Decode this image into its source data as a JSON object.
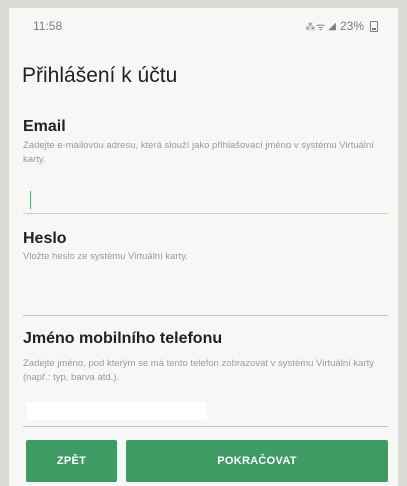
{
  "status_bar": {
    "time": "11:58",
    "network_icons": "66 7",
    "signal_icon": "signal-icon",
    "battery_text": "23%",
    "battery_icon": "battery-icon"
  },
  "page": {
    "title": "Přihlášení k účtu"
  },
  "email": {
    "label": "Email",
    "hint": "Zadejte e-mailovou adresu, která slouží jako přihlašovací jméno v systému Virtuální karty.",
    "value": ""
  },
  "password": {
    "label": "Heslo",
    "hint": "Vložte heslo ze systému Virtuální karty.",
    "value": ""
  },
  "phone_name": {
    "label": "Jméno mobilního telefonu",
    "hint": "Zadejte jméno, pod kterým se má tento telefon zobrazovat v systému Virtuální karty (např.: typ, barva atd.).",
    "value": ""
  },
  "buttons": {
    "back": "ZPĚT",
    "continue": "POKRAČOVAT"
  },
  "colors": {
    "accent": "#3f9b64",
    "focus_line": "#b7dbc8"
  }
}
